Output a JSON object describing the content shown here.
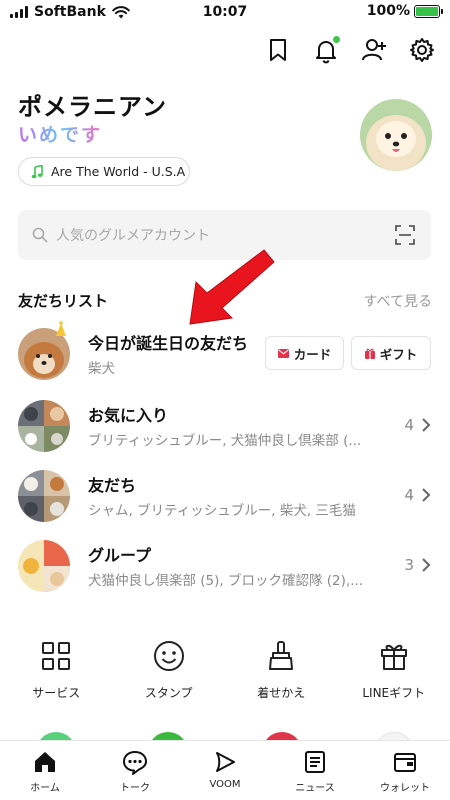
{
  "status_bar": {
    "carrier": "SoftBank",
    "time": "10:07",
    "battery": "100%"
  },
  "header": {
    "icons": [
      "bookmark-icon",
      "bell-icon",
      "add-friend-icon",
      "gear-icon"
    ],
    "notification_dot_color": "#3bc74d"
  },
  "profile": {
    "name": "ポメラニアン",
    "status_message": "いめです",
    "music": "Are The World - U.S.A"
  },
  "search": {
    "placeholder": "人気のグルメアカウント"
  },
  "friends": {
    "title": "友だちリスト",
    "see_all": "すべて見る",
    "birthday": {
      "title": "今日が誕生日の友だち",
      "subtitle": "柴犬",
      "card_label": "カード",
      "gift_label": "ギフト"
    },
    "groups": [
      {
        "title": "お気に入り",
        "subtitle": "ブリティッシュブルー, 犬猫仲良し倶楽部 (...",
        "count": "4"
      },
      {
        "title": "友だち",
        "subtitle": "シャム, ブリティッシュブルー, 柴犬, 三毛猫",
        "count": "4"
      },
      {
        "title": "グループ",
        "subtitle": "犬猫仲良し倶楽部 (5), ブロック確認隊 (2),...",
        "count": "3"
      }
    ]
  },
  "services": [
    {
      "label": "サービス",
      "icon": "grid-icon"
    },
    {
      "label": "スタンプ",
      "icon": "smile-icon"
    },
    {
      "label": "着せかえ",
      "icon": "brush-icon"
    },
    {
      "label": "LINEギフト",
      "icon": "gift-icon"
    }
  ],
  "tabbar": [
    {
      "label": "ホーム",
      "icon": "home-icon"
    },
    {
      "label": "トーク",
      "icon": "chat-icon"
    },
    {
      "label": "VOOM",
      "icon": "voom-icon"
    },
    {
      "label": "ニュース",
      "icon": "news-icon"
    },
    {
      "label": "ウォレット",
      "icon": "wallet-icon"
    }
  ],
  "colors": {
    "accent_green": "#06c755",
    "arrow_red": "#e8141e",
    "badge_red": "#e0344a"
  }
}
